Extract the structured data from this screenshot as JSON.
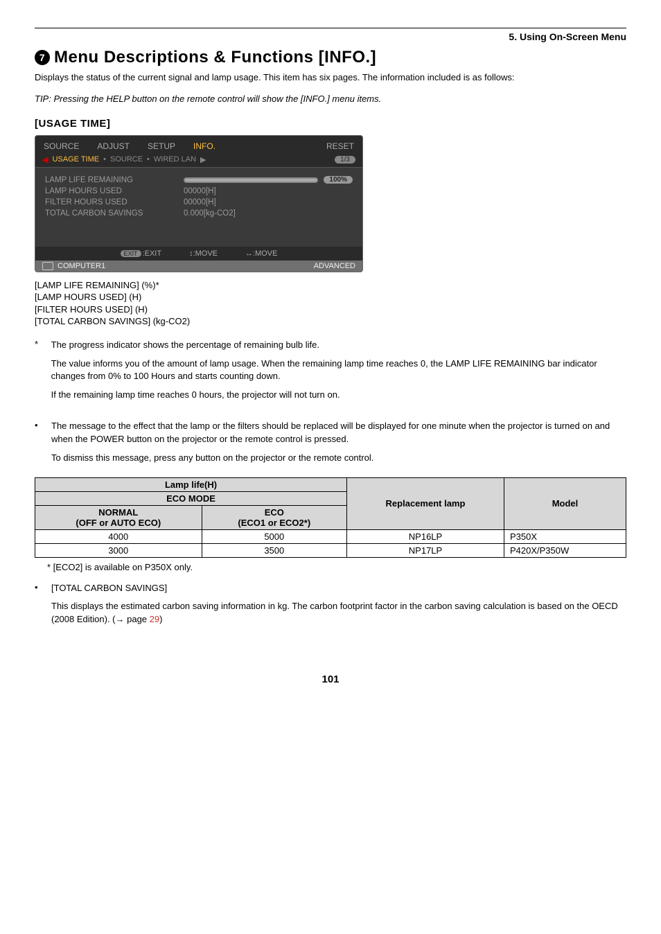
{
  "chapter": "5. Using On-Screen Menu",
  "heading_number": "7",
  "heading_text": "Menu Descriptions & Functions [INFO.]",
  "intro": "Displays the status of the current signal and lamp usage. This item has six pages. The information included is as follows:",
  "tip": "TIP: Pressing the HELP button on the remote control will show the [INFO.] menu items.",
  "sub_heading": "[USAGE TIME]",
  "osd": {
    "tabs": [
      "SOURCE",
      "ADJUST",
      "SETUP",
      "INFO.",
      "RESET"
    ],
    "active_tab_index": 3,
    "subtabs_left_arrow": "◀",
    "subtabs": [
      "USAGE TIME",
      "SOURCE",
      "WIRED LAN"
    ],
    "subtabs_right_arrow": "▶",
    "active_subtab_index": 0,
    "page_indicator": "1/3",
    "rows": [
      {
        "label": "LAMP LIFE REMAINING",
        "type": "progress",
        "pct": "100%"
      },
      {
        "label": "LAMP HOURS USED",
        "type": "value",
        "value": "00000[H]"
      },
      {
        "label": "FILTER HOURS USED",
        "type": "value",
        "value": "00000[H]"
      },
      {
        "label": "TOTAL CARBON SAVINGS",
        "type": "value",
        "value": "0.000[kg-CO2]"
      }
    ],
    "footer": {
      "exit_badge": "EXIT",
      "exit": ":EXIT",
      "move_v": "↕:MOVE",
      "move_h": "↔:MOVE"
    },
    "status_source": "COMPUTER1",
    "status_mode": "ADVANCED"
  },
  "params": [
    "[LAMP LIFE REMAINING] (%)*",
    "[LAMP HOURS USED] (H)",
    "[FILTER HOURS USED] (H)",
    "[TOTAL CARBON SAVINGS] (kg-CO2)"
  ],
  "note": {
    "marker": "*",
    "p1": "The progress indicator shows the percentage of remaining bulb life.",
    "p2": "The value informs you of the amount of lamp usage. When the remaining lamp time reaches 0, the LAMP LIFE REMAINING bar indicator changes from 0% to 100 Hours and starts counting down.",
    "p3": "If the remaining lamp time reaches 0 hours, the projector will not turn on."
  },
  "bullet1": {
    "p1": "The message to the effect that the lamp or the filters should be replaced will be displayed for one minute when the projector is turned on and when the POWER button on the projector or the remote control is pressed.",
    "p2": "To dismiss this message, press any button on the projector or the remote control."
  },
  "table": {
    "head_lamp_life": "Lamp life(H)",
    "head_eco_mode": "ECO MODE",
    "head_normal": "NORMAL",
    "head_normal_sub": "(OFF or AUTO ECO)",
    "head_eco": "ECO",
    "head_eco_sub": "(ECO1 or ECO2*)",
    "head_replacement": "Replacement lamp",
    "head_model": "Model",
    "rows": [
      {
        "normal": "4000",
        "eco": "5000",
        "lamp": "NP16LP",
        "model": "P350X"
      },
      {
        "normal": "3000",
        "eco": "3500",
        "lamp": "NP17LP",
        "model": "P420X/P350W"
      }
    ]
  },
  "table_footnote": "* [ECO2] is available on P350X only.",
  "bullet2": {
    "title": "[TOTAL CARBON SAVINGS]",
    "body_pre": "This displays the estimated carbon saving information in kg. The carbon footprint factor in the carbon saving calculation is based on the OECD (2008 Edition). (→ page ",
    "page_link": "29",
    "body_post": ")"
  },
  "page_number": "101"
}
